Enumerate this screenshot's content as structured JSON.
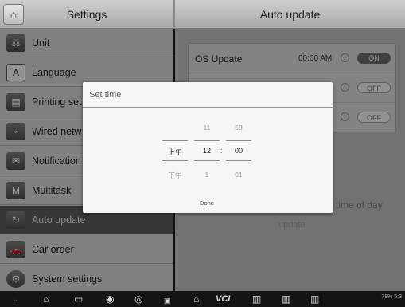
{
  "header": {
    "left_title": "Settings",
    "right_title": "Auto update",
    "home_icon": "home-icon"
  },
  "sidebar": {
    "items": [
      {
        "label": "Unit",
        "icon": "unit-icon"
      },
      {
        "label": "Language",
        "icon": "language-icon"
      },
      {
        "label": "Printing set",
        "icon": "printer-icon"
      },
      {
        "label": "Wired netw",
        "icon": "network-icon"
      },
      {
        "label": "Notification",
        "icon": "notification-icon"
      },
      {
        "label": "Multitask",
        "icon": "multitask-icon"
      },
      {
        "label": "Auto update",
        "icon": "update-icon",
        "active": true
      },
      {
        "label": "Car order",
        "icon": "car-icon"
      },
      {
        "label": "System settings",
        "icon": "gear-icon"
      }
    ]
  },
  "auto_update": {
    "rows": [
      {
        "label": "OS Update",
        "time": "00:00 AM",
        "toggle": "ON"
      },
      {
        "label": "",
        "time": "",
        "toggle": "OFF"
      },
      {
        "label": "",
        "time": "",
        "toggle": "OFF"
      }
    ],
    "hint": "is time of day",
    "hint2": "update"
  },
  "dialog": {
    "title": "Set time",
    "ampm": {
      "above": "",
      "selected": "上午",
      "below": "下午"
    },
    "hour": {
      "above": "11",
      "selected": "12",
      "below": "1"
    },
    "minute": {
      "above": "59",
      "selected": "00",
      "below": "01"
    },
    "colon": ":",
    "done_label": "Done"
  },
  "navbar": {
    "items": [
      "back-icon",
      "home-icon",
      "recents-icon",
      "browser-icon",
      "camera-icon",
      "screenshot-icon",
      "autel-home-icon",
      "vci-icon",
      "diagnostics-icon",
      "service-icon",
      "shop-icon"
    ],
    "vci_label": "VCI",
    "status_text": "78% 5:3"
  },
  "colors": {
    "sidebar_active": "#5a5a5a",
    "toggle_on": "#6a6a6a",
    "bottom_bar": "#141414"
  }
}
